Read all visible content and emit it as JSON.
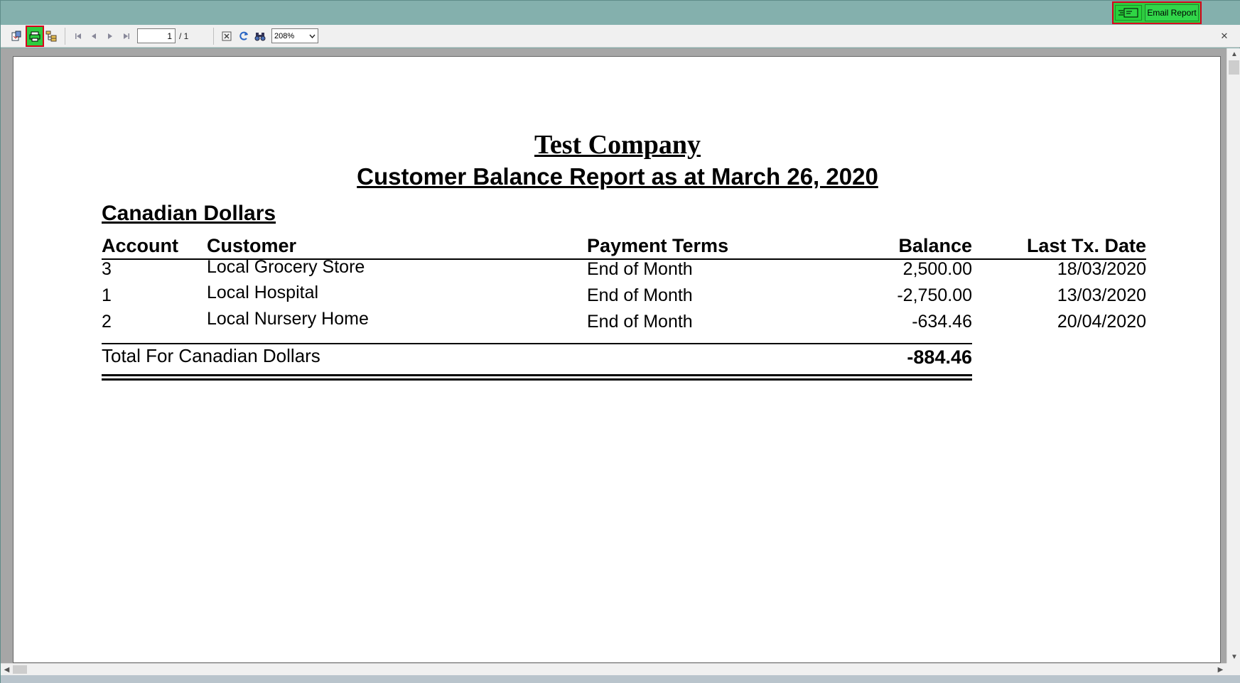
{
  "email_button": {
    "label": "Email Report",
    "icon": "email-report-icon"
  },
  "toolbar": {
    "export_icon": "export-icon",
    "print_icon": "printer-icon",
    "group_tree_icon": "group-tree-icon",
    "first_page_icon": "first-page-icon",
    "prev_page_icon": "prev-page-icon",
    "next_page_icon": "next-page-icon",
    "last_page_icon": "last-page-icon",
    "page_current": "1",
    "page_total": "/ 1",
    "stop_icon": "stop-icon",
    "refresh_icon": "refresh-icon",
    "search_icon": "binoculars-icon",
    "zoom_value": "208%",
    "close_label": "✕"
  },
  "report": {
    "company": "Test Company",
    "title": "Customer Balance Report as at March 26, 2020",
    "currency_heading": "Canadian Dollars",
    "columns": {
      "account": "Account",
      "customer": "Customer",
      "payment_terms": "Payment Terms",
      "balance": "Balance",
      "last_tx_date": "Last Tx. Date"
    },
    "rows": [
      {
        "account": "3",
        "customer": "Local Grocery Store",
        "payment_terms": "End of Month",
        "balance": "2,500.00",
        "last_tx_date": "18/03/2020"
      },
      {
        "account": "1",
        "customer": "Local Hospital",
        "payment_terms": "End of Month",
        "balance": "-2,750.00",
        "last_tx_date": "13/03/2020"
      },
      {
        "account": "2",
        "customer": "Local Nursery Home",
        "payment_terms": "End of Month",
        "balance": "-634.46",
        "last_tx_date": "20/04/2020"
      }
    ],
    "total_label": "Total For Canadian Dollars",
    "total_value": "-884.46"
  },
  "colors": {
    "highlight_green": "#2ecc40",
    "highlight_red": "#d8001c",
    "title_bar": "#84b0ad"
  }
}
